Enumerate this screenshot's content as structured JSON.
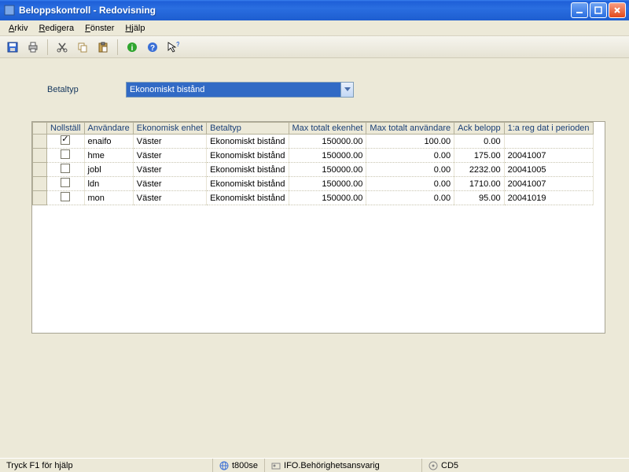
{
  "window": {
    "title": "Beloppskontroll - Redovisning"
  },
  "menu": {
    "arkiv": "Arkiv",
    "redigera": "Redigera",
    "fonster": "Fönster",
    "hjalp": "Hjälp"
  },
  "form": {
    "betaltyp_label": "Betaltyp",
    "betaltyp_value": "Ekonomiskt bistånd"
  },
  "table": {
    "headers": {
      "nollstall": "Nollställ",
      "anvandare": "Användare",
      "ekonomisk_enhet": "Ekonomisk enhet",
      "betaltyp": "Betaltyp",
      "max_totalt_ekenhet": "Max totalt ekenhet",
      "max_totalt_anvandare": "Max totalt användare",
      "ack_belopp": "Ack belopp",
      "reg_dat": "1:a reg dat i perioden"
    },
    "rows": [
      {
        "checked": true,
        "anv": "enaifo",
        "enhet": "Väster",
        "betaltyp": "Ekonomiskt bistånd",
        "max_ek": "150000.00",
        "max_anv": "100.00",
        "ack": "0.00",
        "reg": ""
      },
      {
        "checked": false,
        "anv": "hme",
        "enhet": "Väster",
        "betaltyp": "Ekonomiskt bistånd",
        "max_ek": "150000.00",
        "max_anv": "0.00",
        "ack": "175.00",
        "reg": "20041007"
      },
      {
        "checked": false,
        "anv": "jobl",
        "enhet": "Väster",
        "betaltyp": "Ekonomiskt bistånd",
        "max_ek": "150000.00",
        "max_anv": "0.00",
        "ack": "2232.00",
        "reg": "20041005"
      },
      {
        "checked": false,
        "anv": "ldn",
        "enhet": "Väster",
        "betaltyp": "Ekonomiskt bistånd",
        "max_ek": "150000.00",
        "max_anv": "0.00",
        "ack": "1710.00",
        "reg": "20041007"
      },
      {
        "checked": false,
        "anv": "mon",
        "enhet": "Väster",
        "betaltyp": "Ekonomiskt bistånd",
        "max_ek": "150000.00",
        "max_anv": "0.00",
        "ack": "95.00",
        "reg": "20041019"
      }
    ]
  },
  "status": {
    "hint": "Tryck F1 för hjälp",
    "server": "t800se",
    "role": "IFO.Behörighetsansvarig",
    "code": "CD5"
  }
}
